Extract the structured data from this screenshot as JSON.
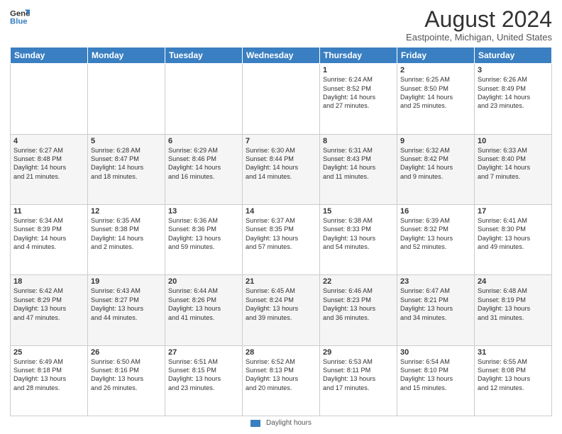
{
  "header": {
    "logo_line1": "General",
    "logo_line2": "Blue",
    "title": "August 2024",
    "subtitle": "Eastpointe, Michigan, United States"
  },
  "columns": [
    "Sunday",
    "Monday",
    "Tuesday",
    "Wednesday",
    "Thursday",
    "Friday",
    "Saturday"
  ],
  "weeks": [
    [
      {
        "day": "",
        "text": ""
      },
      {
        "day": "",
        "text": ""
      },
      {
        "day": "",
        "text": ""
      },
      {
        "day": "",
        "text": ""
      },
      {
        "day": "1",
        "text": "Sunrise: 6:24 AM\nSunset: 8:52 PM\nDaylight: 14 hours\nand 27 minutes."
      },
      {
        "day": "2",
        "text": "Sunrise: 6:25 AM\nSunset: 8:50 PM\nDaylight: 14 hours\nand 25 minutes."
      },
      {
        "day": "3",
        "text": "Sunrise: 6:26 AM\nSunset: 8:49 PM\nDaylight: 14 hours\nand 23 minutes."
      }
    ],
    [
      {
        "day": "4",
        "text": "Sunrise: 6:27 AM\nSunset: 8:48 PM\nDaylight: 14 hours\nand 21 minutes."
      },
      {
        "day": "5",
        "text": "Sunrise: 6:28 AM\nSunset: 8:47 PM\nDaylight: 14 hours\nand 18 minutes."
      },
      {
        "day": "6",
        "text": "Sunrise: 6:29 AM\nSunset: 8:46 PM\nDaylight: 14 hours\nand 16 minutes."
      },
      {
        "day": "7",
        "text": "Sunrise: 6:30 AM\nSunset: 8:44 PM\nDaylight: 14 hours\nand 14 minutes."
      },
      {
        "day": "8",
        "text": "Sunrise: 6:31 AM\nSunset: 8:43 PM\nDaylight: 14 hours\nand 11 minutes."
      },
      {
        "day": "9",
        "text": "Sunrise: 6:32 AM\nSunset: 8:42 PM\nDaylight: 14 hours\nand 9 minutes."
      },
      {
        "day": "10",
        "text": "Sunrise: 6:33 AM\nSunset: 8:40 PM\nDaylight: 14 hours\nand 7 minutes."
      }
    ],
    [
      {
        "day": "11",
        "text": "Sunrise: 6:34 AM\nSunset: 8:39 PM\nDaylight: 14 hours\nand 4 minutes."
      },
      {
        "day": "12",
        "text": "Sunrise: 6:35 AM\nSunset: 8:38 PM\nDaylight: 14 hours\nand 2 minutes."
      },
      {
        "day": "13",
        "text": "Sunrise: 6:36 AM\nSunset: 8:36 PM\nDaylight: 13 hours\nand 59 minutes."
      },
      {
        "day": "14",
        "text": "Sunrise: 6:37 AM\nSunset: 8:35 PM\nDaylight: 13 hours\nand 57 minutes."
      },
      {
        "day": "15",
        "text": "Sunrise: 6:38 AM\nSunset: 8:33 PM\nDaylight: 13 hours\nand 54 minutes."
      },
      {
        "day": "16",
        "text": "Sunrise: 6:39 AM\nSunset: 8:32 PM\nDaylight: 13 hours\nand 52 minutes."
      },
      {
        "day": "17",
        "text": "Sunrise: 6:41 AM\nSunset: 8:30 PM\nDaylight: 13 hours\nand 49 minutes."
      }
    ],
    [
      {
        "day": "18",
        "text": "Sunrise: 6:42 AM\nSunset: 8:29 PM\nDaylight: 13 hours\nand 47 minutes."
      },
      {
        "day": "19",
        "text": "Sunrise: 6:43 AM\nSunset: 8:27 PM\nDaylight: 13 hours\nand 44 minutes."
      },
      {
        "day": "20",
        "text": "Sunrise: 6:44 AM\nSunset: 8:26 PM\nDaylight: 13 hours\nand 41 minutes."
      },
      {
        "day": "21",
        "text": "Sunrise: 6:45 AM\nSunset: 8:24 PM\nDaylight: 13 hours\nand 39 minutes."
      },
      {
        "day": "22",
        "text": "Sunrise: 6:46 AM\nSunset: 8:23 PM\nDaylight: 13 hours\nand 36 minutes."
      },
      {
        "day": "23",
        "text": "Sunrise: 6:47 AM\nSunset: 8:21 PM\nDaylight: 13 hours\nand 34 minutes."
      },
      {
        "day": "24",
        "text": "Sunrise: 6:48 AM\nSunset: 8:19 PM\nDaylight: 13 hours\nand 31 minutes."
      }
    ],
    [
      {
        "day": "25",
        "text": "Sunrise: 6:49 AM\nSunset: 8:18 PM\nDaylight: 13 hours\nand 28 minutes."
      },
      {
        "day": "26",
        "text": "Sunrise: 6:50 AM\nSunset: 8:16 PM\nDaylight: 13 hours\nand 26 minutes."
      },
      {
        "day": "27",
        "text": "Sunrise: 6:51 AM\nSunset: 8:15 PM\nDaylight: 13 hours\nand 23 minutes."
      },
      {
        "day": "28",
        "text": "Sunrise: 6:52 AM\nSunset: 8:13 PM\nDaylight: 13 hours\nand 20 minutes."
      },
      {
        "day": "29",
        "text": "Sunrise: 6:53 AM\nSunset: 8:11 PM\nDaylight: 13 hours\nand 17 minutes."
      },
      {
        "day": "30",
        "text": "Sunrise: 6:54 AM\nSunset: 8:10 PM\nDaylight: 13 hours\nand 15 minutes."
      },
      {
        "day": "31",
        "text": "Sunrise: 6:55 AM\nSunset: 8:08 PM\nDaylight: 13 hours\nand 12 minutes."
      }
    ]
  ],
  "footer": {
    "legend_label": "Daylight hours"
  }
}
